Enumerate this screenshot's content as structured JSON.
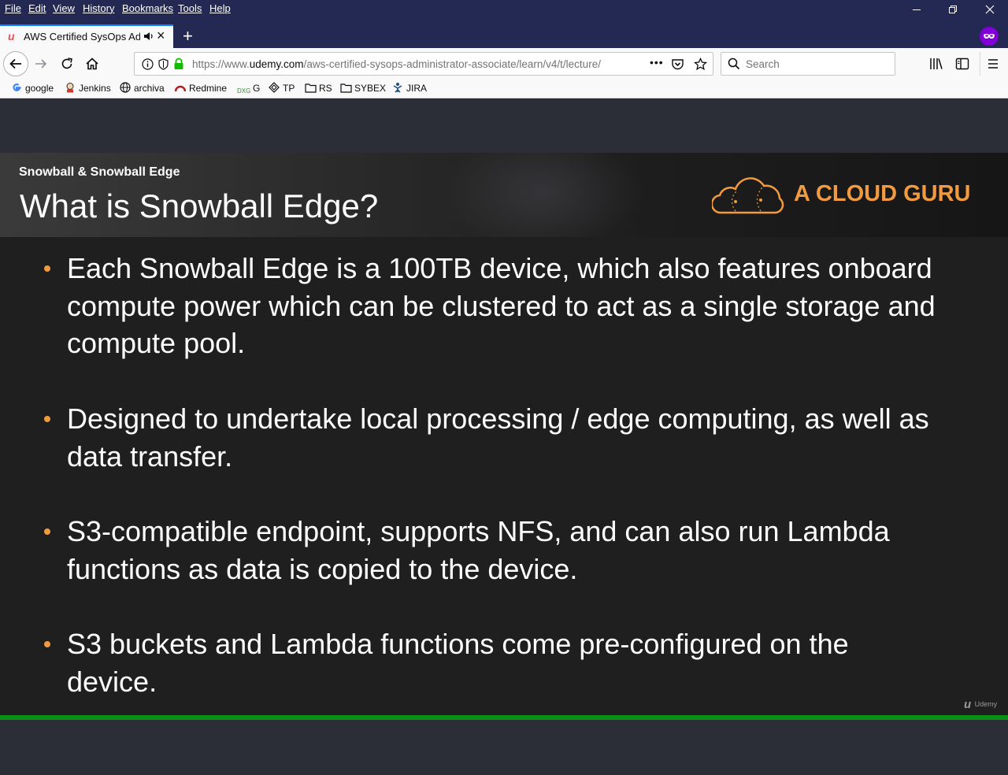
{
  "menu": {
    "items": [
      "File",
      "Edit",
      "View",
      "History",
      "Bookmarks",
      "Tools",
      "Help"
    ]
  },
  "tab": {
    "title": "AWS Certified SysOps Admin",
    "close": "×",
    "new_tab": "+"
  },
  "nav": {
    "url_prefix": "https://www.",
    "url_domain": "udemy.com",
    "url_path": "/aws-certified-sysops-administrator-associate/learn/v4/t/lecture/",
    "page_actions": "•••",
    "search_placeholder": "Search"
  },
  "bookmarks": [
    "google",
    "Jenkins",
    "archiva",
    "Redmine",
    "G",
    "TP",
    "RS",
    "SYBEX",
    "JIRA"
  ],
  "slide": {
    "subtitle": "Snowball & Snowball Edge",
    "title": "What is Snowball Edge?",
    "brand": "A CLOUD GURU",
    "bullets": [
      [
        "Each Snowball Edge is a 100TB device, which also features onboard",
        "compute power which can be clustered to act as a single storage and",
        "compute pool."
      ],
      [
        "Designed to undertake local processing / edge computing, as well as",
        "data transfer."
      ],
      [
        "S3-compatible endpoint, supports NFS, and can also run Lambda",
        "functions as data is copied to the device."
      ],
      [
        "S3 buckets and Lambda functions come pre-configured on the",
        "device."
      ]
    ],
    "watermark": "Udemy"
  },
  "colors": {
    "accent_orange": "#f29a3f",
    "progress_green": "#0a8f14",
    "titlebar": "#232952"
  }
}
